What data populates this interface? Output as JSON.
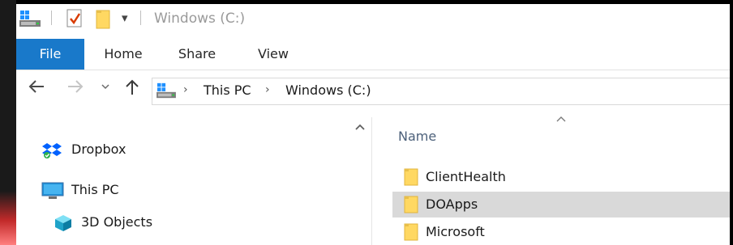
{
  "window": {
    "title": "Windows (C:)",
    "qat_dropdown": "▾"
  },
  "ribbon": {
    "tabs": [
      {
        "label": "File",
        "active": true
      },
      {
        "label": "Home"
      },
      {
        "label": "Share"
      },
      {
        "label": "View"
      }
    ]
  },
  "address_bar": {
    "breadcrumbs": [
      "This PC",
      "Windows (C:)"
    ],
    "separator": "›"
  },
  "nav_pane": {
    "items": [
      {
        "label": "Dropbox",
        "icon": "dropbox-icon"
      },
      {
        "label": "This PC",
        "icon": "computer-icon"
      },
      {
        "label": "3D Objects",
        "icon": "3d-objects-icon"
      }
    ]
  },
  "file_list": {
    "column_name": "Name",
    "rows": [
      {
        "name": "ClientHealth",
        "selected": false
      },
      {
        "name": "DOApps",
        "selected": true
      },
      {
        "name": "Microsoft",
        "selected": false
      }
    ]
  },
  "colors": {
    "accent": "#1979ca",
    "selection": "#d9d9d9",
    "folder": "#ffd862"
  }
}
